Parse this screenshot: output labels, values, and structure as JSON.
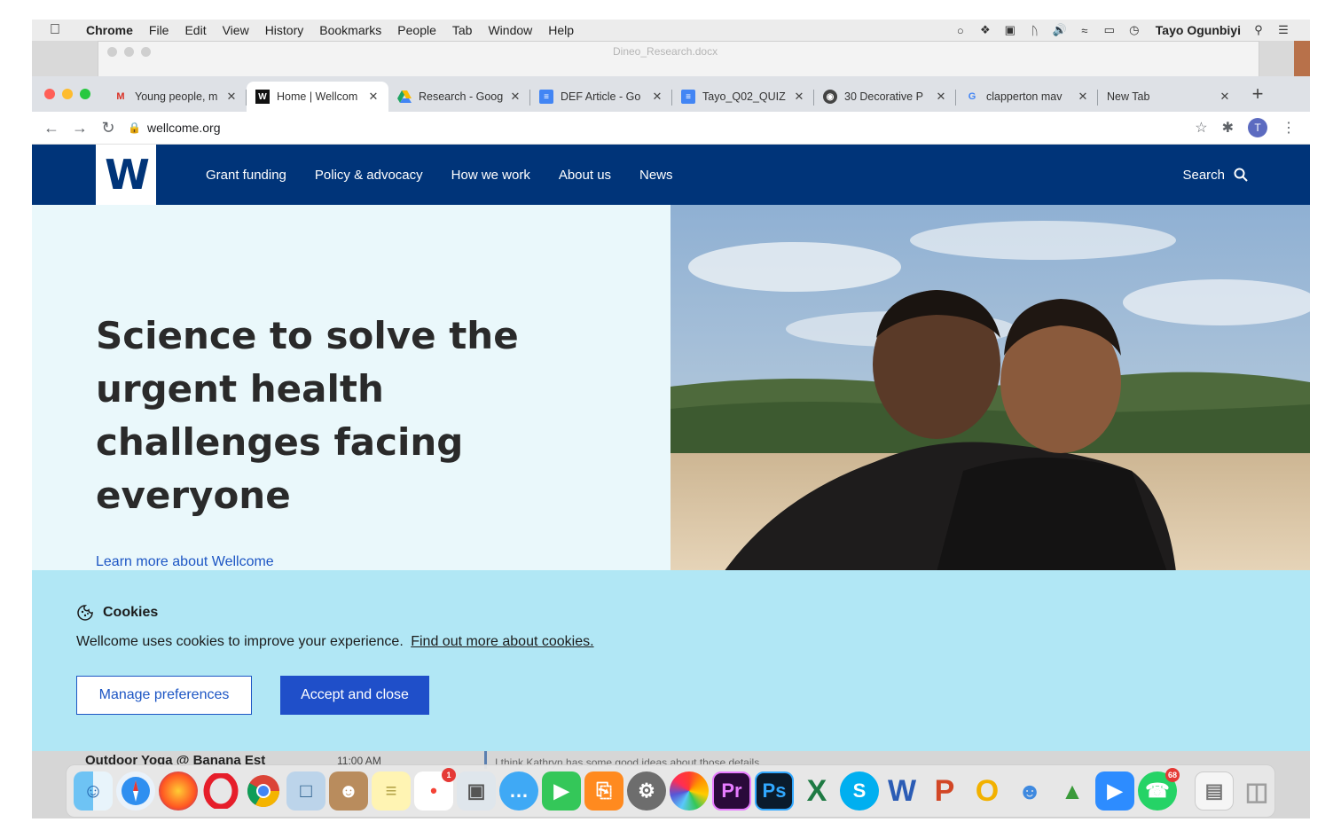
{
  "menubar": {
    "app": "Chrome",
    "items": [
      "File",
      "Edit",
      "View",
      "History",
      "Bookmarks",
      "People",
      "Tab",
      "Window",
      "Help"
    ],
    "user": "Tayo Ogunbiyi"
  },
  "background_window": {
    "doc_title": "Dineo_Research.docx"
  },
  "tabs": [
    {
      "label": "Young people, m",
      "icon": "gmail-icon",
      "active": false
    },
    {
      "label": "Home | Wellcom",
      "icon": "wellcome-icon",
      "active": true
    },
    {
      "label": "Research - Goog",
      "icon": "drive-icon",
      "active": false
    },
    {
      "label": "DEF Article - Go",
      "icon": "docs-icon",
      "active": false
    },
    {
      "label": "Tayo_Q02_QUIZ",
      "icon": "docs-icon",
      "active": false
    },
    {
      "label": "30 Decorative P",
      "icon": "globe-icon",
      "active": false
    },
    {
      "label": "clapperton mav",
      "icon": "google-icon",
      "active": false
    },
    {
      "label": "New Tab",
      "icon": "",
      "active": false
    }
  ],
  "toolbar": {
    "url": "wellcome.org",
    "avatar_letter": "T"
  },
  "site": {
    "logo_letter": "W",
    "nav": [
      "Grant funding",
      "Policy & advocacy",
      "How we work",
      "About us",
      "News"
    ],
    "search_label": "Search"
  },
  "hero": {
    "title": "Science to solve the urgent health challenges facing everyone",
    "link": "Learn more about Wellcome"
  },
  "cookie": {
    "heading": "Cookies",
    "text": "Wellcome uses cookies to improve your experience.",
    "link": "Find out more about cookies.",
    "manage_label": "Manage preferences",
    "accept_label": "Accept and close"
  },
  "background_calendar": {
    "event": "Outdoor Yoga @ Banana Est",
    "time": "11:00 AM",
    "note": "I think Kathryn has some good ideas about those details"
  },
  "dock": {
    "reminders_badge": "1",
    "whatsapp_badge": "68",
    "apps": [
      "finder",
      "safari",
      "firefox",
      "opera",
      "chrome",
      "preview",
      "contacts",
      "notes",
      "reminders",
      "image-capture",
      "messages",
      "facetime",
      "books",
      "system-preferences",
      "photos",
      "premiere",
      "photoshop",
      "excel",
      "skype",
      "word",
      "powerpoint",
      "outlook",
      "teams",
      "archive",
      "zoom",
      "whatsapp",
      "document",
      "trash"
    ]
  },
  "colors": {
    "brand_navy": "#003479",
    "hero_bg": "#eaf8fb",
    "cookie_bg": "#b1e7f5",
    "link_blue": "#1d56c4",
    "accept_blue": "#1f4fc9"
  }
}
